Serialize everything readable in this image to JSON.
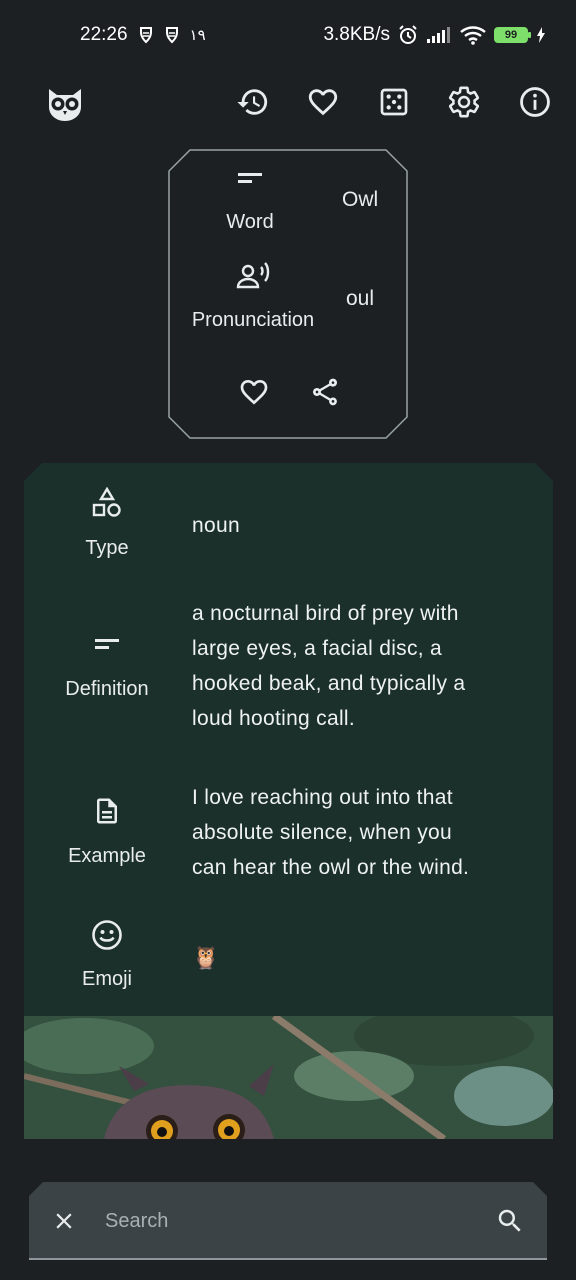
{
  "status_bar": {
    "time": "22:26",
    "extra": "۱۹",
    "net_speed": "3.8KB/s",
    "battery": "99"
  },
  "toolbar": {
    "icons": [
      "owl-logo-icon",
      "history-icon",
      "heart-icon",
      "dice-icon",
      "settings-icon",
      "info-icon"
    ]
  },
  "word_card": {
    "word_label": "Word",
    "word_value": "Owl",
    "pronunciation_label": "Pronunciation",
    "pronunciation_value": "oul"
  },
  "definition": {
    "type_label": "Type",
    "type_value": "noun",
    "definition_label": "Definition",
    "definition_lines": [
      "a nocturnal bird of prey with",
      "large eyes, a facial disc, a",
      "hooked beak, and typically a",
      "loud hooting call."
    ],
    "example_label": "Example",
    "example_lines": [
      "I love reaching out into that",
      "absolute silence, when you",
      "can hear the owl or the wind."
    ],
    "emoji_label": "Emoji",
    "emoji_value": "🦉"
  },
  "search": {
    "placeholder": "Search"
  },
  "colors": {
    "background": "#1c2022",
    "panel": "#1b2f2b",
    "search_bar": "#3b4346",
    "battery": "#7ee06a"
  }
}
